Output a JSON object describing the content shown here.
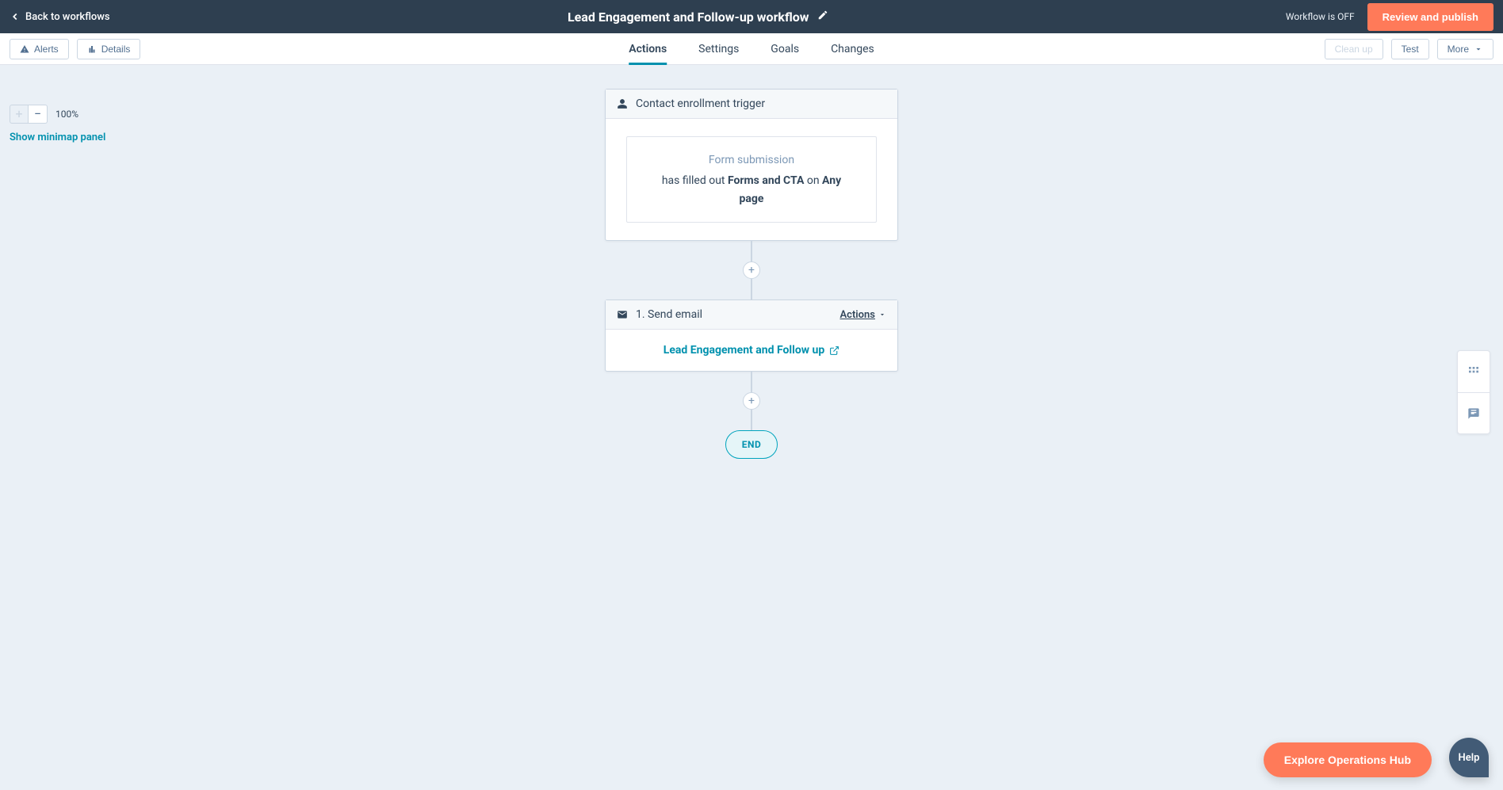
{
  "header": {
    "back_label": "Back to workflows",
    "title": "Lead Engagement and Follow-up workflow",
    "status": "Workflow is OFF",
    "publish_label": "Review and publish"
  },
  "toolbar": {
    "alerts_label": "Alerts",
    "details_label": "Details",
    "cleanup_label": "Clean up",
    "test_label": "Test",
    "more_label": "More"
  },
  "tabs": [
    {
      "id": "actions",
      "label": "Actions",
      "active": true
    },
    {
      "id": "settings",
      "label": "Settings",
      "active": false
    },
    {
      "id": "goals",
      "label": "Goals",
      "active": false
    },
    {
      "id": "changes",
      "label": "Changes",
      "active": false
    }
  ],
  "zoom": {
    "percent": "100%",
    "minimap_label": "Show minimap panel"
  },
  "flow": {
    "trigger": {
      "header": "Contact enrollment trigger",
      "sub": "Form submission",
      "text_prefix": "has filled out ",
      "form_name": "Forms and CTA",
      "on_word": " on ",
      "page_name": "Any page"
    },
    "step1": {
      "prefix": "1. ",
      "label": "Send email",
      "actions_label": "Actions",
      "email_name": "Lead Engagement and Follow up"
    },
    "end_label": "END"
  },
  "floating": {
    "explore_label": "Explore Operations Hub",
    "help_label": "Help"
  }
}
